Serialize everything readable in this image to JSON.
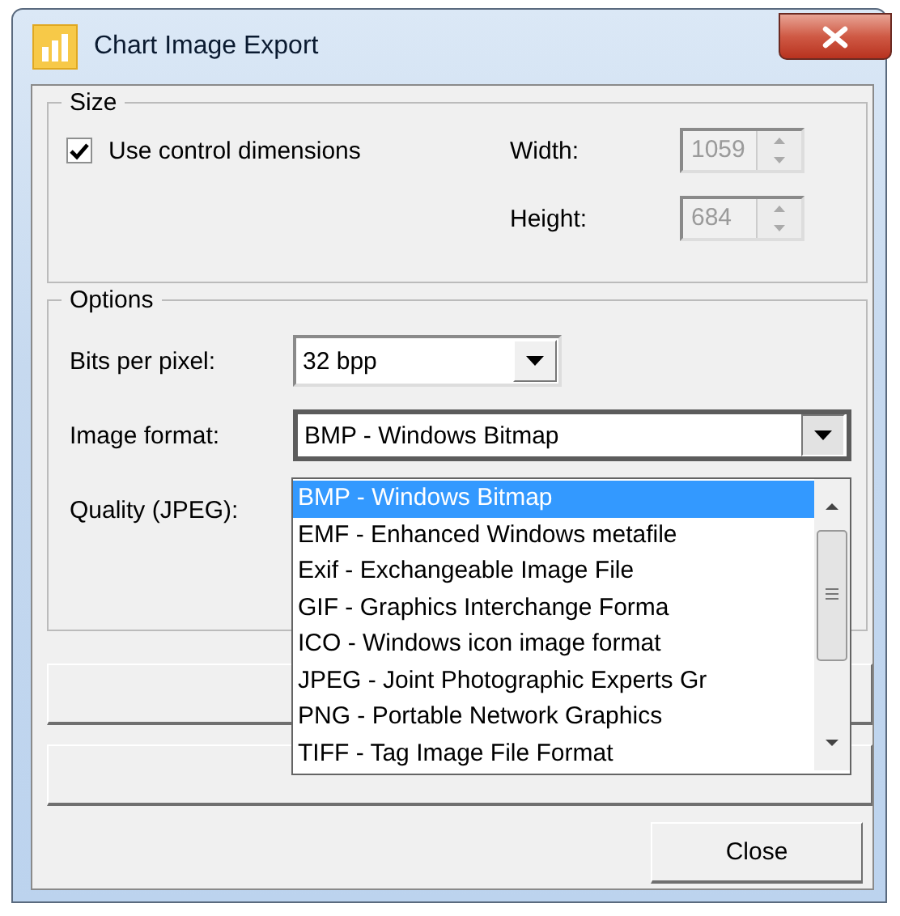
{
  "window": {
    "title": "Chart Image Export"
  },
  "size": {
    "legend": "Size",
    "use_control_dimensions": {
      "label": "Use control dimensions",
      "checked": true
    },
    "width": {
      "label": "Width:",
      "value": "1059",
      "disabled": true
    },
    "height": {
      "label": "Height:",
      "value": "684",
      "disabled": true
    }
  },
  "options": {
    "legend": "Options",
    "bits_per_pixel": {
      "label": "Bits per pixel:",
      "value": "32 bpp"
    },
    "image_format": {
      "label": "Image format:",
      "value": "BMP - Windows Bitmap",
      "expanded": true,
      "items": [
        {
          "label": "BMP - Windows Bitmap",
          "selected": true
        },
        {
          "label": "EMF - Enhanced Windows metafile",
          "selected": false
        },
        {
          "label": "Exif - Exchangeable Image File",
          "selected": false
        },
        {
          "label": "GIF - Graphics Interchange Forma",
          "selected": false
        },
        {
          "label": "ICO - Windows icon image format",
          "selected": false
        },
        {
          "label": "JPEG - Joint Photographic Experts Gr",
          "selected": false
        },
        {
          "label": "PNG - Portable Network Graphics",
          "selected": false
        },
        {
          "label": "TIFF - Tag Image File Format",
          "selected": false
        }
      ]
    },
    "quality": {
      "label": "Quality (JPEG):"
    }
  },
  "close_button": {
    "label": "Close"
  }
}
